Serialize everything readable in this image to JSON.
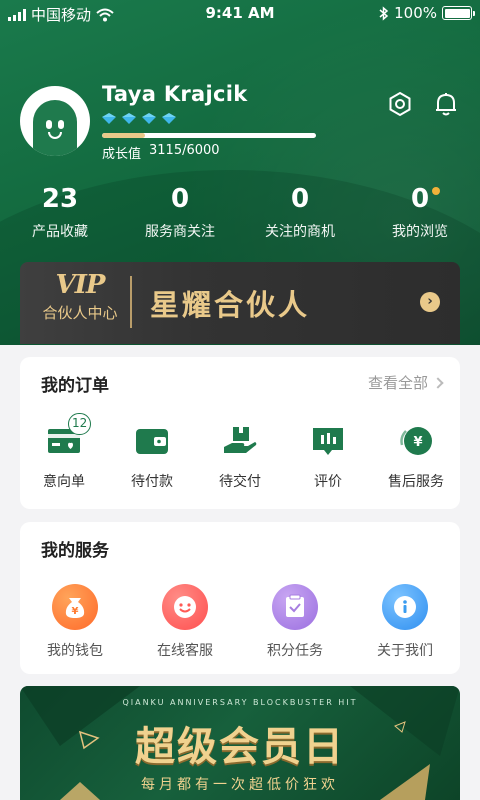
{
  "status_bar": {
    "carrier": "中国移动",
    "time": "9:41 AM",
    "battery": "100%"
  },
  "profile": {
    "name": "Taya Krajcik",
    "level_diamonds": 4,
    "growth_label": "成长值",
    "growth_value": "3115/6000",
    "growth_progress": 0.2
  },
  "stats": [
    {
      "value": "23",
      "label": "产品收藏"
    },
    {
      "value": "0",
      "label": "服务商关注"
    },
    {
      "value": "0",
      "label": "关注的商机"
    },
    {
      "value": "0",
      "label": "我的浏览"
    }
  ],
  "vip": {
    "logo": "VIP",
    "subtitle": "合伙人中心",
    "title": "星耀合伙人"
  },
  "orders": {
    "title": "我的订单",
    "view_all": "查看全部",
    "items": [
      {
        "label": "意向单",
        "icon": "card-icon",
        "badge": "12"
      },
      {
        "label": "待付款",
        "icon": "wallet-icon"
      },
      {
        "label": "待交付",
        "icon": "hand-box-icon"
      },
      {
        "label": "评价",
        "icon": "comment-icon"
      },
      {
        "label": "售后服务",
        "icon": "after-sales-icon"
      }
    ]
  },
  "services": {
    "title": "我的服务",
    "items": [
      {
        "label": "我的钱包",
        "icon": "money-bag-icon",
        "color": "#ff7a2f"
      },
      {
        "label": "在线客服",
        "icon": "smile-icon",
        "color": "#ff5a55"
      },
      {
        "label": "积分任务",
        "icon": "task-icon",
        "color": "#a77ee0"
      },
      {
        "label": "关于我们",
        "icon": "info-icon",
        "color": "#3a9cf0"
      }
    ]
  },
  "banner": {
    "english": "QIANKU ANNIVERSARY BLOCKBUSTER HIT",
    "title": "超级会员日",
    "subtitle": "每月都有一次超低价狂欢"
  },
  "colors": {
    "primary": "#1f7a4d",
    "gold": "#e9c98a",
    "badge_dot": "#f1b23a"
  }
}
